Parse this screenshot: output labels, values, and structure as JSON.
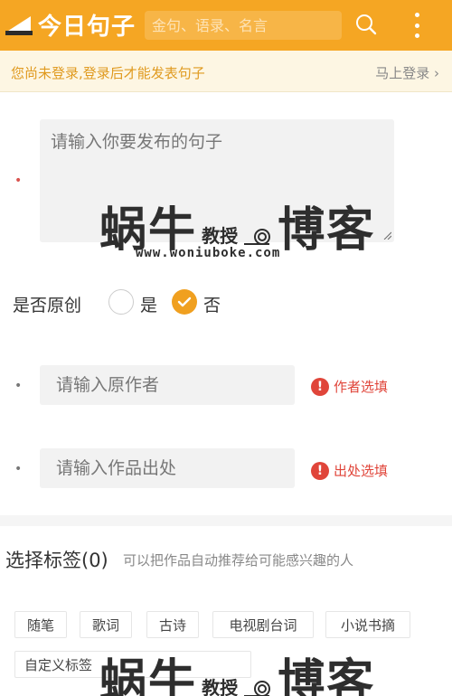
{
  "header": {
    "logo_text": "今日句子",
    "search_placeholder": "金句、语录、名言",
    "icons": {
      "search": "search-icon",
      "menu": "more-vertical-icon",
      "logo": "logo-icon"
    }
  },
  "notice": {
    "text": "您尚未登录,登录后才能发表句子",
    "link": "马上登录 ›"
  },
  "form": {
    "content_placeholder": "请输入你要发布的句子",
    "original": {
      "label": "是否原创",
      "options": [
        {
          "label": "是",
          "selected": false
        },
        {
          "label": "否",
          "selected": true
        }
      ]
    },
    "author_placeholder": "请输入原作者",
    "author_hint": "作者选填",
    "source_placeholder": "请输入作品出处",
    "source_hint": "出处选填",
    "hint_icon": "!"
  },
  "tags": {
    "title": "选择标签",
    "count": "(0)",
    "description": "可以把作品自动推荐给可能感兴趣的人",
    "items": [
      "随笔",
      "歌词",
      "古诗",
      "电视剧台词",
      "小说书摘",
      "自定义标签"
    ]
  },
  "watermark": {
    "brand_a": "蜗牛",
    "brand_b": "教授",
    "brand_c": "博客",
    "url": "www.woniuboke.com"
  },
  "colors": {
    "brand": "#f5a623",
    "notice_bg": "#fdf6e3",
    "notice_text": "#e09a1f",
    "hint_red": "#e0453a",
    "radio_selected": "#f0a020"
  }
}
